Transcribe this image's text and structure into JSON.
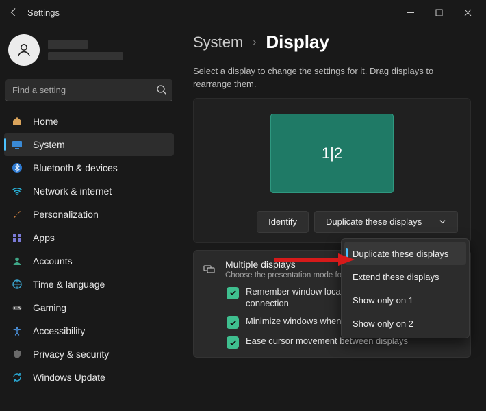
{
  "title": "Settings",
  "search": {
    "placeholder": "Find a setting"
  },
  "sidebar": {
    "items": [
      {
        "label": "Home"
      },
      {
        "label": "System"
      },
      {
        "label": "Bluetooth & devices"
      },
      {
        "label": "Network & internet"
      },
      {
        "label": "Personalization"
      },
      {
        "label": "Apps"
      },
      {
        "label": "Accounts"
      },
      {
        "label": "Time & language"
      },
      {
        "label": "Gaming"
      },
      {
        "label": "Accessibility"
      },
      {
        "label": "Privacy & security"
      },
      {
        "label": "Windows Update"
      }
    ]
  },
  "breadcrumb": {
    "parent": "System",
    "current": "Display"
  },
  "description": "Select a display to change the settings for it. Drag displays to rearrange them.",
  "monitor_label": "1|2",
  "identify_btn": "Identify",
  "mode_dropdown": "Duplicate these displays",
  "menu": {
    "items": [
      "Duplicate these displays",
      "Extend these displays",
      "Show only on 1",
      "Show only on 2"
    ]
  },
  "multi": {
    "title": "Multiple displays",
    "sub": "Choose the presentation mode for your displays",
    "opt1": "Remember window locations based on monitor connection",
    "opt2": "Minimize windows when a monitor is disconnected",
    "opt3": "Ease cursor movement between displays"
  }
}
